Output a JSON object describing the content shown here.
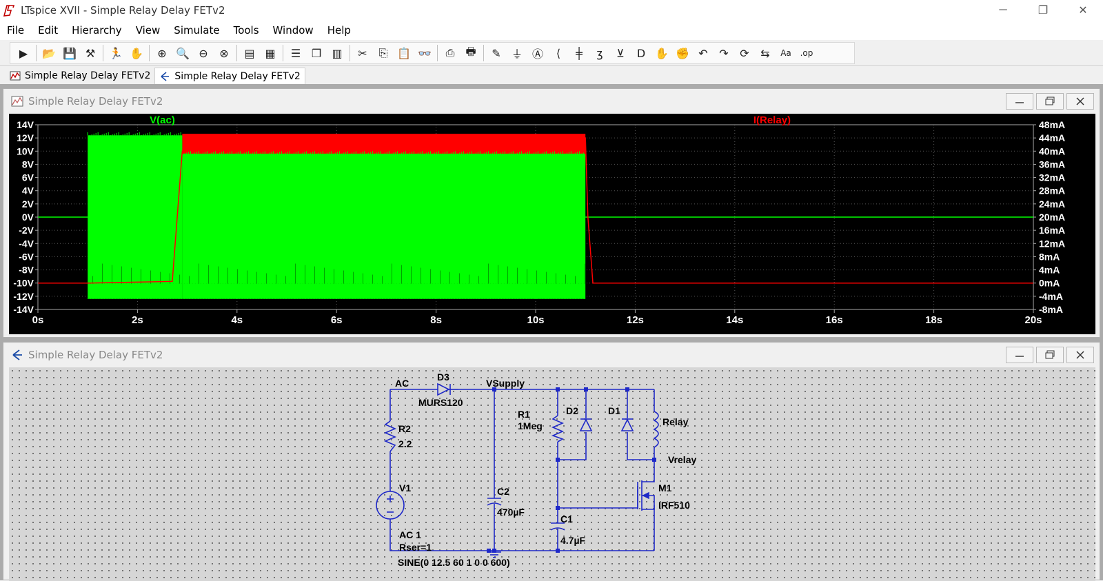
{
  "window": {
    "title": "LTspice XVII - Simple Relay Delay FETv2",
    "controls": [
      "─",
      "❐",
      "✕"
    ]
  },
  "menu": [
    "File",
    "Edit",
    "Hierarchy",
    "View",
    "Simulate",
    "Tools",
    "Window",
    "Help"
  ],
  "toolbar_icons": [
    "new-schematic-icon",
    "open-icon",
    "save-icon",
    "control-panel-icon",
    "run-icon",
    "halt-icon",
    "zoom-in-icon",
    "zoom-area-icon",
    "zoom-out-icon",
    "zoom-fit-icon",
    "autorange-icon",
    "grid-icon",
    "tile-horizontal-icon",
    "cascade-icon",
    "tile-vertical-icon",
    "cut-icon",
    "copy-icon",
    "paste-icon",
    "find-icon",
    "print-setup-icon",
    "print-icon",
    "draw-wire-icon",
    "ground-icon",
    "label-net-icon",
    "resistor-icon",
    "capacitor-icon",
    "inductor-icon",
    "diode-icon",
    "component-icon",
    "move-icon",
    "drag-icon",
    "undo-icon",
    "redo-icon",
    "rotate-icon",
    "mirror-icon",
    "text-icon",
    "spice-directive-icon"
  ],
  "tabs": [
    {
      "label": "Simple Relay Delay FETv2",
      "icon": "waveform-icon",
      "active": false
    },
    {
      "label": "Simple Relay Delay FETv2",
      "icon": "schematic-icon",
      "active": true
    }
  ],
  "plot_window": {
    "title": "Simple Relay Delay FETv2",
    "buttons": [
      "minimize",
      "maximize",
      "close"
    ]
  },
  "schematic_window": {
    "title": "Simple Relay Delay FETv2",
    "buttons": [
      "minimize",
      "maximize",
      "close"
    ]
  },
  "chart_data": {
    "type": "line",
    "background": "#000000",
    "grid": true,
    "series": [
      {
        "name": "V(ac)",
        "color": "#00ff00",
        "axis": "left",
        "description_points": {
          "x": [
            0,
            1.0,
            1.0,
            2.9,
            2.9,
            11.0,
            11.0,
            20
          ],
          "y_high": [
            0,
            12,
            12,
            12,
            10,
            10,
            0,
            0
          ],
          "y_low": [
            0,
            -12,
            -12,
            -12,
            -12,
            -12,
            0,
            0
          ]
        }
      },
      {
        "name": "I(Relay)",
        "color": "#ff0000",
        "axis": "right",
        "x": [
          0,
          1.0,
          2.7,
          2.9,
          3.0,
          11.0,
          11.05,
          11.15,
          20
        ],
        "y": [
          0,
          0,
          0.5,
          40,
          44,
          44,
          20,
          0,
          0
        ]
      }
    ],
    "xaxis": {
      "min": 0,
      "max": 20,
      "ticks": [
        0,
        2,
        4,
        6,
        8,
        10,
        12,
        14,
        16,
        18,
        20
      ],
      "tick_labels": [
        "0s",
        "2s",
        "4s",
        "6s",
        "8s",
        "10s",
        "12s",
        "14s",
        "16s",
        "18s",
        "20s"
      ]
    },
    "yaxis_left": {
      "min": -14,
      "max": 14,
      "tick_labels": [
        "14V",
        "12V",
        "10V",
        "8V",
        "6V",
        "4V",
        "2V",
        "0V",
        "-2V",
        "-4V",
        "-6V",
        "-8V",
        "-10V",
        "-12V",
        "-14V"
      ]
    },
    "yaxis_right": {
      "min": -8,
      "max": 48,
      "tick_labels": [
        "48mA",
        "44mA",
        "40mA",
        "36mA",
        "32mA",
        "28mA",
        "24mA",
        "20mA",
        "16mA",
        "12mA",
        "8mA",
        "4mA",
        "0mA",
        "-4mA",
        "-8mA"
      ]
    }
  },
  "schematic": {
    "nets": {
      "ac": "AC",
      "vsupply": "VSupply",
      "vrelay": "Vrelay"
    },
    "components": {
      "d3": {
        "ref": "D3",
        "value": "MURS120"
      },
      "r2": {
        "ref": "R2",
        "value": "2.2"
      },
      "v1": {
        "ref": "V1",
        "line1": "AC 1",
        "line2": "Rser=1",
        "line3": "SINE(0 12.5 60 1 0 0 600)"
      },
      "c2": {
        "ref": "C2",
        "value": "470µF"
      },
      "r1": {
        "ref": "R1",
        "value": "1Meg"
      },
      "d2": {
        "ref": "D2"
      },
      "d1": {
        "ref": "D1"
      },
      "relay": {
        "ref": "Relay"
      },
      "m1": {
        "ref": "M1",
        "value": "IRF510"
      },
      "c1": {
        "ref": "C1",
        "value": "4.7µF"
      }
    }
  }
}
